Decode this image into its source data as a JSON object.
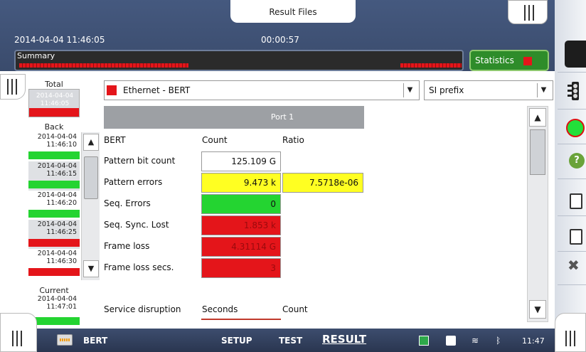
{
  "header": {
    "result_files_tab": "Result Files",
    "datetime": "2014-04-04 11:46:05",
    "elapsed": "00:00:57",
    "summary_label": "Summary",
    "statistics_button": "Statistics"
  },
  "history": {
    "total_label": "Total",
    "total_date": "2014-04-04",
    "total_time": "11:46:05",
    "back_label": "Back",
    "items": [
      {
        "date": "2014-04-04",
        "time": "11:46:10",
        "status": "green"
      },
      {
        "date": "2014-04-04",
        "time": "11:46:15",
        "status": "green"
      },
      {
        "date": "2014-04-04",
        "time": "11:46:20",
        "status": "green"
      },
      {
        "date": "2014-04-04",
        "time": "11:46:25",
        "status": "red"
      },
      {
        "date": "2014-04-04",
        "time": "11:46:30",
        "status": "red"
      }
    ],
    "current_label": "Current",
    "current_date": "2014-04-04",
    "current_time": "11:47:01"
  },
  "selectors": {
    "interface": "Ethernet - BERT",
    "prefix": "SI prefix"
  },
  "table": {
    "port_header": "Port 1",
    "col_bert": "BERT",
    "col_count": "Count",
    "col_ratio": "Ratio",
    "rows": [
      {
        "label": "Pattern bit count",
        "count": "125.109 G",
        "ratio": ""
      },
      {
        "label": "Pattern errors",
        "count": "9.473 k",
        "ratio": "7.5718e-06"
      },
      {
        "label": "Seq. Errors",
        "count": "0",
        "ratio": ""
      },
      {
        "label": "Seq. Sync. Lost",
        "count": "1.853 k",
        "ratio": ""
      },
      {
        "label": "Frame loss",
        "count": "4.31114 G",
        "ratio": ""
      },
      {
        "label": "Frame loss secs.",
        "count": "3",
        "ratio": ""
      }
    ],
    "service_disruption": "Service disruption",
    "svc_seconds": "Seconds",
    "svc_count": "Count"
  },
  "bottom": {
    "app_name": "BERT",
    "tab_setup": "SETUP",
    "tab_test": "TEST",
    "tab_result": "RESULT",
    "clock": "11:47"
  },
  "colors": {
    "error_red": "#e4151a",
    "ok_green": "#24d431",
    "warn_yellow": "#ffff22",
    "frame_blue": "#3a4b6c"
  },
  "icons": [
    "battery-plug-icon",
    "camera-icon",
    "wifi-icon",
    "bluetooth-icon",
    "traffic-light-icon",
    "record-icon",
    "help-icon",
    "report-icon",
    "edit-report-icon",
    "tools-icon",
    "chevron-down-icon",
    "chevron-up-icon"
  ]
}
